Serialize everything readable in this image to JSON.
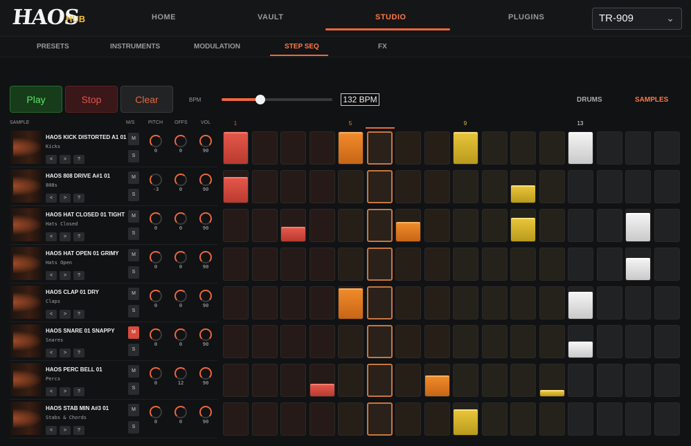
{
  "header": {
    "logo": "HAOS",
    "logo_sub": "HUB",
    "nav": [
      "HOME",
      "VAULT",
      "STUDIO",
      "PLUGINS"
    ],
    "active_nav": "STUDIO",
    "kit_select": "TR-909"
  },
  "subnav": {
    "items": [
      "PRESETS",
      "INSTRUMENTS",
      "MODULATION",
      "STEP SEQ",
      "FX"
    ],
    "active": "STEP SEQ"
  },
  "transport": {
    "play": "Play",
    "stop": "Stop",
    "clear": "Clear",
    "bpm_label": "BPM",
    "bpm_value": "132 BPM",
    "bpm_slider_fraction": 0.35,
    "mode_drums": "DRUMS",
    "mode_samples": "SAMPLES",
    "active_mode": "SAMPLES"
  },
  "columns": {
    "sample": "SAMPLE",
    "ms": "M/S",
    "pitch": "PITCH",
    "offs": "OFFS",
    "vol": "VOL"
  },
  "step_numbers": [
    "1",
    "5",
    "9",
    "13"
  ],
  "playhead_step": 6,
  "colors": {
    "accent": "#f0683a",
    "step_red": "#e3574a",
    "step_orange": "#f08a2a",
    "step_yellow": "#e7c43a",
    "step_white": "#f3f3f3",
    "mute_on": "#d84a3a"
  },
  "tracks": [
    {
      "name": "HAOS KICK DISTORTED A1 01",
      "category": "Kicks",
      "mute": false,
      "pitch": "0",
      "offs": "0",
      "vol": "90",
      "steps": [
        1,
        0,
        0,
        0,
        1,
        0,
        0,
        0,
        1,
        0,
        0,
        0,
        1,
        0,
        0,
        0
      ]
    },
    {
      "name": "HAOS 808 DRIVE A#1 01",
      "category": "808s",
      "mute": false,
      "pitch": "-3",
      "offs": "0",
      "vol": "90",
      "steps": [
        0.8,
        0,
        0,
        0,
        0,
        0,
        0,
        0,
        0,
        0,
        0.55,
        0,
        0,
        0,
        0,
        0
      ]
    },
    {
      "name": "HAOS HAT CLOSED 01 TIGHT",
      "category": "Hats Closed",
      "mute": false,
      "pitch": "0",
      "offs": "0",
      "vol": "90",
      "steps": [
        0,
        0,
        0.45,
        0,
        0,
        0,
        0.6,
        0,
        0,
        0,
        0.75,
        0,
        0,
        0,
        0.9,
        0
      ]
    },
    {
      "name": "HAOS HAT OPEN 01 GRIMY",
      "category": "Hats Open",
      "mute": false,
      "pitch": "0",
      "offs": "0",
      "vol": "90",
      "steps": [
        0,
        0,
        0,
        0,
        0,
        0,
        0,
        0,
        0,
        0,
        0,
        0,
        0,
        0,
        0.7,
        0
      ]
    },
    {
      "name": "HAOS CLAP 01 DRY",
      "category": "Claps",
      "mute": false,
      "pitch": "0",
      "offs": "0",
      "vol": "90",
      "steps": [
        0,
        0,
        0,
        0,
        0.95,
        0,
        0,
        0,
        0,
        0,
        0,
        0,
        0.85,
        0,
        0,
        0
      ]
    },
    {
      "name": "HAOS SNARE 01 SNAPPY",
      "category": "Snares",
      "mute": true,
      "pitch": "0",
      "offs": "0",
      "vol": "90",
      "steps": [
        0,
        0,
        0,
        0,
        0,
        0,
        0,
        0,
        0,
        0,
        0,
        0,
        0.5,
        0,
        0,
        0
      ]
    },
    {
      "name": "HAOS PERC BELL 01",
      "category": "Percs",
      "mute": false,
      "pitch": "0",
      "offs": "12",
      "vol": "90",
      "steps": [
        0,
        0,
        0,
        0.4,
        0,
        0,
        0,
        0.65,
        0,
        0,
        0,
        0.2,
        0,
        0,
        0,
        0
      ]
    },
    {
      "name": "HAOS STAB MIN A#3 01",
      "category": "Stabs & Chords",
      "mute": false,
      "pitch": "0",
      "offs": "0",
      "vol": "90",
      "steps": [
        0,
        0,
        0,
        0,
        0,
        0,
        0,
        0,
        0.8,
        0,
        0,
        0,
        0,
        0,
        0,
        0
      ]
    }
  ],
  "sample_nav": {
    "prev": "<",
    "next": ">",
    "help": "?"
  },
  "ms_labels": {
    "mute": "M",
    "solo": "S"
  }
}
